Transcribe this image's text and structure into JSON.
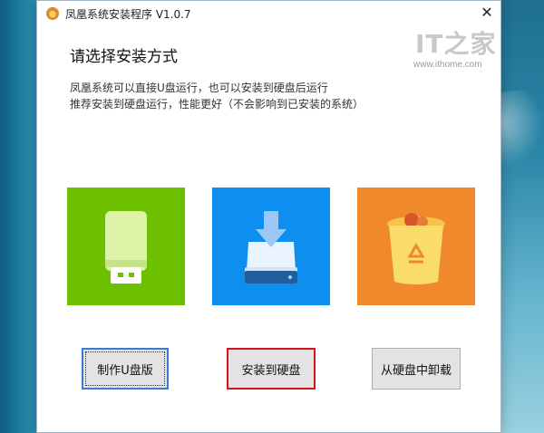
{
  "window": {
    "title": "凤凰系统安装程序 V1.0.7",
    "close_label": "✕"
  },
  "main": {
    "heading": "请选择安装方式",
    "description": [
      "凤凰系统可以直接U盘运行，也可以安装到硬盘后运行",
      "推荐安装到硬盘运行，性能更好（不会影响到已安装的系统）"
    ]
  },
  "watermark": {
    "logo": "IT之家",
    "url": "www.ithome.com"
  },
  "options": [
    {
      "icon": "usb-drive-icon",
      "color": "#6cc000",
      "button_label": "制作U盘版"
    },
    {
      "icon": "install-to-disk-icon",
      "color": "#0e8ff0",
      "button_label": "安装到硬盘"
    },
    {
      "icon": "recycle-bin-icon",
      "color": "#f0892c",
      "button_label": "从硬盘中卸载"
    }
  ]
}
